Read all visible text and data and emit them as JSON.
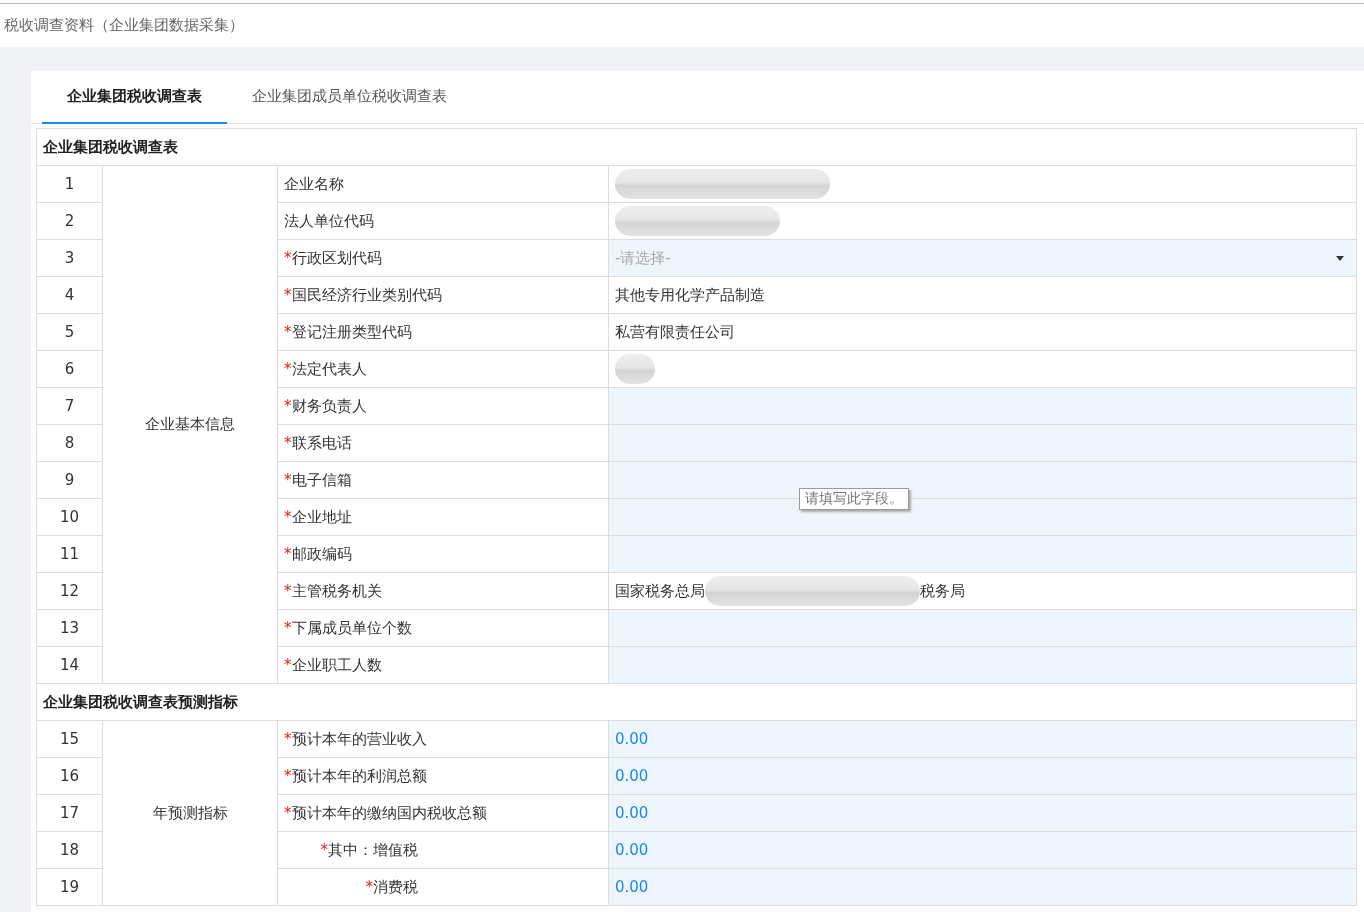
{
  "page_title": "税收调查资料（企业集团数据采集）",
  "tabs": [
    {
      "label": "企业集团税收调查表",
      "selected": true
    },
    {
      "label": "企业集团成员单位税收调查表",
      "selected": false
    }
  ],
  "sections": [
    {
      "title": "企业集团税收调查表",
      "group_label": "企业基本信息",
      "rows": [
        {
          "no": "1",
          "label": "企业名称",
          "kind": "text",
          "parts": [
            {
              "kind": "blur_long"
            }
          ]
        },
        {
          "no": "2",
          "label": "法人单位代码",
          "kind": "text",
          "parts": [
            {
              "kind": "blur_medium"
            }
          ]
        },
        {
          "no": "3",
          "mark": "*",
          "label": "行政区划代码",
          "kind": "select",
          "placeholder": "-请选择-"
        },
        {
          "no": "4",
          "mark": "*",
          "label": "国民经济行业类别代码",
          "kind": "text",
          "parts": [
            {
              "kind": "text",
              "text": "其他专用化学产品制造"
            }
          ]
        },
        {
          "no": "5",
          "mark": "*",
          "label": "登记注册类型代码",
          "kind": "text",
          "parts": [
            {
              "kind": "text",
              "text": "私营有限责任公司"
            }
          ]
        },
        {
          "no": "6",
          "mark": "*",
          "label": "法定代表人",
          "kind": "text",
          "parts": [
            {
              "kind": "blur_short"
            }
          ]
        },
        {
          "no": "7",
          "mark": "*",
          "label": "财务负责人",
          "kind": "input"
        },
        {
          "no": "8",
          "mark": "*",
          "label": "联系电话",
          "kind": "input"
        },
        {
          "no": "9",
          "mark": "*",
          "label": "电子信箱",
          "kind": "input",
          "tooltip": "请填写此字段。"
        },
        {
          "no": "10",
          "mark": "*",
          "label": "企业地址",
          "kind": "input"
        },
        {
          "no": "11",
          "mark": "*",
          "label": "邮政编码",
          "kind": "input"
        },
        {
          "no": "12",
          "mark": "*",
          "label": "主管税务机关",
          "kind": "text",
          "parts": [
            {
              "kind": "text",
              "text": "国家税务总局"
            },
            {
              "kind": "blur_long"
            },
            {
              "kind": "text",
              "text": "税务局"
            }
          ]
        },
        {
          "no": "13",
          "mark": "*",
          "label": "下属成员单位个数",
          "kind": "input"
        },
        {
          "no": "14",
          "mark": "*",
          "label": "企业职工人数",
          "kind": "input"
        }
      ]
    },
    {
      "title": "企业集团税收调查表预测指标",
      "group_label": "年预测指标",
      "rows": [
        {
          "no": "15",
          "mark": "*",
          "label": "预计本年的营业收入",
          "kind": "number",
          "value": "0.00"
        },
        {
          "no": "16",
          "mark": "*",
          "label": "预计本年的利润总额",
          "kind": "number",
          "value": "0.00"
        },
        {
          "no": "17",
          "mark": "*",
          "label": "预计本年的缴纳国内税收总额",
          "kind": "number",
          "value": "0.00"
        },
        {
          "no": "18",
          "mark": "*",
          "label": "其中：增值税",
          "kind": "number",
          "value": "0.00",
          "sub": true
        },
        {
          "no": "19",
          "mark": "*",
          "label": "消费税",
          "kind": "number",
          "value": "0.00",
          "sub": true
        }
      ]
    }
  ]
}
